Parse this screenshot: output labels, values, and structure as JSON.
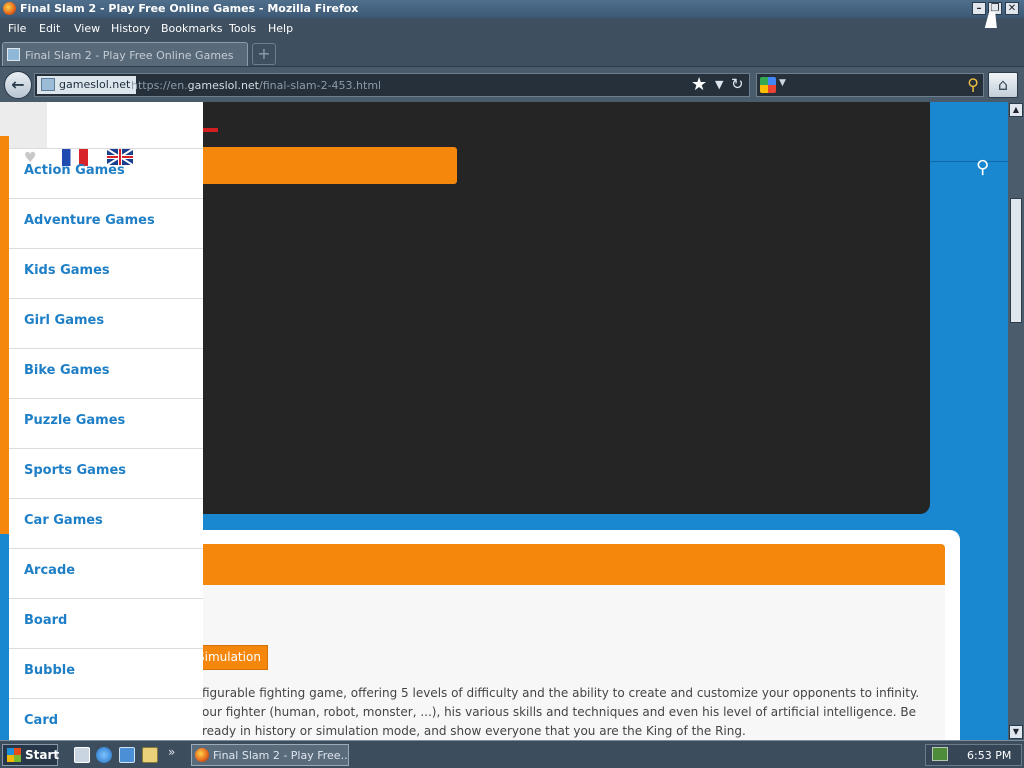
{
  "window": {
    "title": "Final Slam 2 - Play Free Online Games - Mozilla Firefox",
    "min_label": "–",
    "restore_label": "❐",
    "close_label": "✕"
  },
  "menu": {
    "items": [
      "File",
      "Edit",
      "View",
      "History",
      "Bookmarks",
      "Tools",
      "Help"
    ]
  },
  "tabs": [
    {
      "label": "Final Slam 2 - Play Free Online Games"
    }
  ],
  "newtab_label": "+",
  "nav": {
    "site_identity": "gameslol.net",
    "url_prefix": "https://en.",
    "url_domain": "gameslol.net",
    "url_path": "/final-slam-2-453.html",
    "back_icon": "←",
    "star_icon": "★",
    "dropdown_icon": "▼",
    "reload_icon": "↻",
    "search_placeholder": "",
    "home_icon": "⌂"
  },
  "sidebar": {
    "items": [
      {
        "label": "Action Games"
      },
      {
        "label": "Adventure Games"
      },
      {
        "label": "Kids Games"
      },
      {
        "label": "Girl Games"
      },
      {
        "label": "Bike Games"
      },
      {
        "label": "Puzzle Games"
      },
      {
        "label": "Sports Games"
      },
      {
        "label": "Car Games"
      },
      {
        "label": "Arcade"
      },
      {
        "label": "Board"
      },
      {
        "label": "Bubble"
      },
      {
        "label": "Card"
      }
    ]
  },
  "content": {
    "tag_label": "Simulation",
    "description": "figurable fighting game, offering 5 levels of difficulty and the ability to create and customize your opponents to infinity. our fighter (human, robot, monster, ...), his various skills and techniques and even his level of artificial intelligence. Be ready in history or simulation mode, and show everyone that you are the King of the Ring.",
    "search_icon": "🔍"
  },
  "taskbar": {
    "start_label": "Start",
    "task_label": "Final Slam 2 - Play Free...",
    "clock": "6:53 PM",
    "chevron": "»"
  },
  "colors": {
    "orange": "#f5870d",
    "blue": "#1a88d0",
    "dark_panel": "#252525",
    "sidebar_link": "#1f7fc6"
  }
}
